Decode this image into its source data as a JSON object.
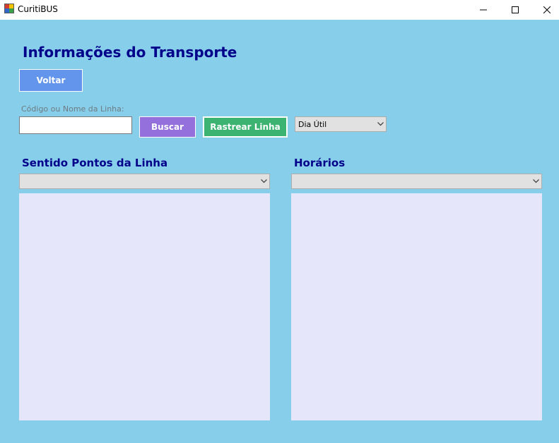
{
  "window": {
    "title": "CuritiBUS",
    "icon": "app-window-icon",
    "controls": [
      "minimize-icon",
      "maximize-icon",
      "close-icon"
    ]
  },
  "page": {
    "heading": "Informações do Transporte",
    "back_button": "Voltar"
  },
  "search": {
    "label": "Código ou Nome da Linha:",
    "value": "",
    "search_button": "Buscar",
    "track_button": "Rastrear Linha",
    "day_type_selected": "Dia Útil"
  },
  "sections": {
    "stops_title": "Sentido Pontos da Linha",
    "stops_selected": "",
    "schedules_title": "Horários",
    "schedules_selected": ""
  },
  "colors": {
    "background": "#87ceeb",
    "heading": "#00008b",
    "back_button": "#6495ed",
    "search_button": "#9370db",
    "track_button": "#3cb371",
    "listbox": "#e6e6fa"
  }
}
